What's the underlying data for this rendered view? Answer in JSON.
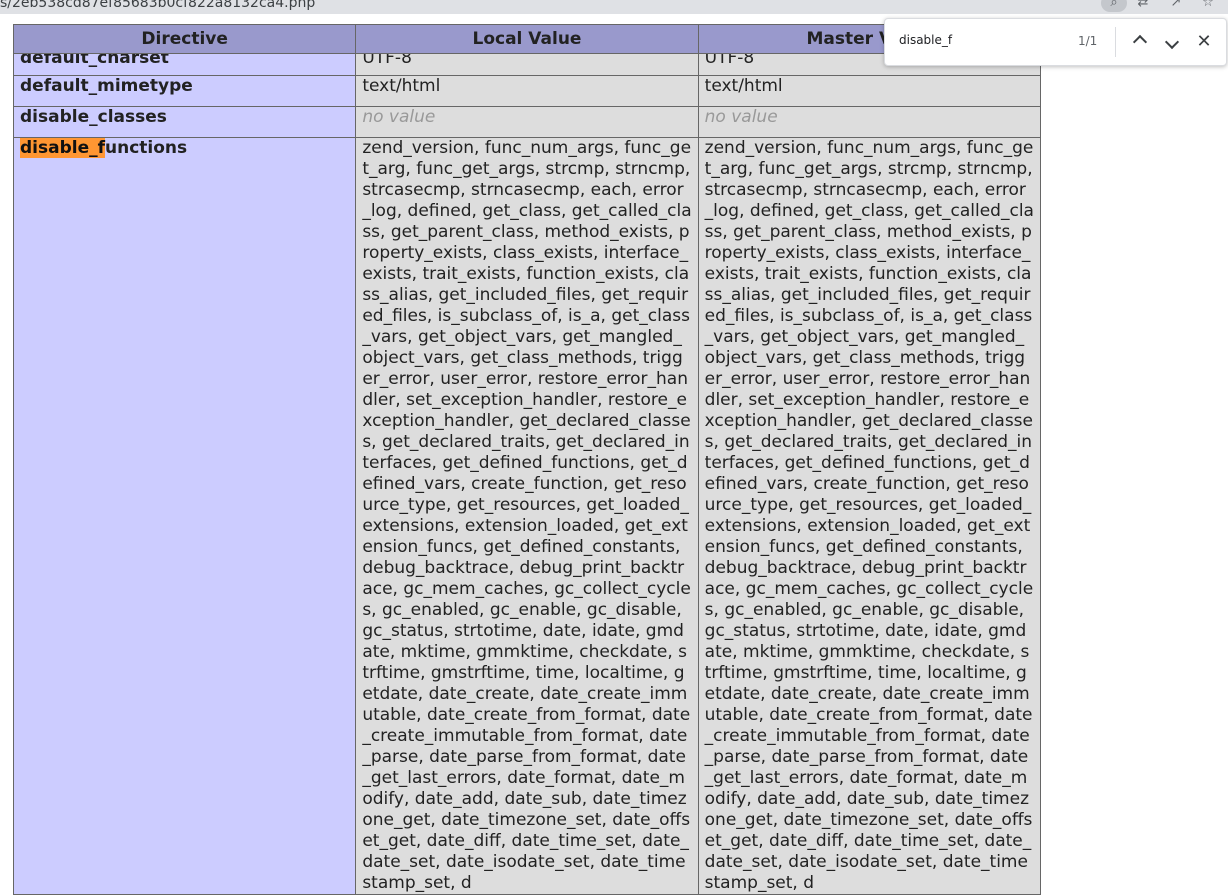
{
  "browser": {
    "url": "s/2eb538cd87ef85683b0cf822a8132ca4.php",
    "icons": [
      "zoom-icon",
      "translate-icon",
      "share-icon",
      "bookmark-star-icon"
    ]
  },
  "find_bar": {
    "query": "disable_f",
    "count": "1/1"
  },
  "table": {
    "headers": [
      "Directive",
      "Local Value",
      "Master Value"
    ],
    "rows": [
      {
        "directive": "default_charset",
        "local": "UTF-8",
        "master": "UTF-8"
      },
      {
        "directive": "default_mimetype",
        "local": "text/html",
        "master": "text/html"
      },
      {
        "directive": "disable_classes",
        "local": "no value",
        "master": "no value"
      },
      {
        "directive_match": "disable_f",
        "directive_rest": "unctions",
        "local": "zend_version, func_num_args, func_get_arg, func_get_args, strcmp, strncmp, strcasecmp, strncasecmp, each, error_log, defined, get_class, get_called_class, get_parent_class, method_exists, property_exists, class_exists, interface_exists, trait_exists, function_exists, class_alias, get_included_files, get_required_files, is_subclass_of, is_a, get_class_vars, get_object_vars, get_mangled_object_vars, get_class_methods, trigger_error, user_error, restore_error_handler, set_exception_handler, restore_exception_handler, get_declared_classes, get_declared_traits, get_declared_interfaces, get_defined_functions, get_defined_vars, create_function, get_resource_type, get_resources, get_loaded_extensions, extension_loaded, get_extension_funcs, get_defined_constants, debug_backtrace, debug_print_backtrace, gc_mem_caches, gc_collect_cycles, gc_enabled, gc_enable, gc_disable, gc_status, strtotime, date, idate, gmdate, mktime, gmmktime, checkdate, strftime, gmstrftime, time, localtime, getdate, date_create, date_create_immutable, date_create_from_format, date_create_immutable_from_format, date_parse, date_parse_from_format, date_get_last_errors, date_format, date_modify, date_add, date_sub, date_timezone_get, date_timezone_set, date_offset_get, date_diff, date_time_set, date_date_set, date_isodate_set, date_timestamp_set, d",
        "master": "zend_version, func_num_args, func_get_arg, func_get_args, strcmp, strncmp, strcasecmp, strncasecmp, each, error_log, defined, get_class, get_called_class, get_parent_class, method_exists, property_exists, class_exists, interface_exists, trait_exists, function_exists, class_alias, get_included_files, get_required_files, is_subclass_of, is_a, get_class_vars, get_object_vars, get_mangled_object_vars, get_class_methods, trigger_error, user_error, restore_error_handler, set_exception_handler, restore_exception_handler, get_declared_classes, get_declared_traits, get_declared_interfaces, get_defined_functions, get_defined_vars, create_function, get_resource_type, get_resources, get_loaded_extensions, extension_loaded, get_extension_funcs, get_defined_constants, debug_backtrace, debug_print_backtrace, gc_mem_caches, gc_collect_cycles, gc_enabled, gc_enable, gc_disable, gc_status, strtotime, date, idate, gmdate, mktime, gmmktime, checkdate, strftime, gmstrftime, time, localtime, getdate, date_create, date_create_immutable, date_create_from_format, date_create_immutable_from_format, date_parse, date_parse_from_format, date_get_last_errors, date_format, date_modify, date_add, date_sub, date_timezone_get, date_timezone_set, date_offset_get, date_diff, date_time_set, date_date_set, date_isodate_set, date_timestamp_set, d"
      }
    ]
  },
  "colors": {
    "header_bg": "#9999cc",
    "directive_bg": "#ccccff",
    "value_bg": "#dddddd",
    "highlight": "#ff9632"
  }
}
